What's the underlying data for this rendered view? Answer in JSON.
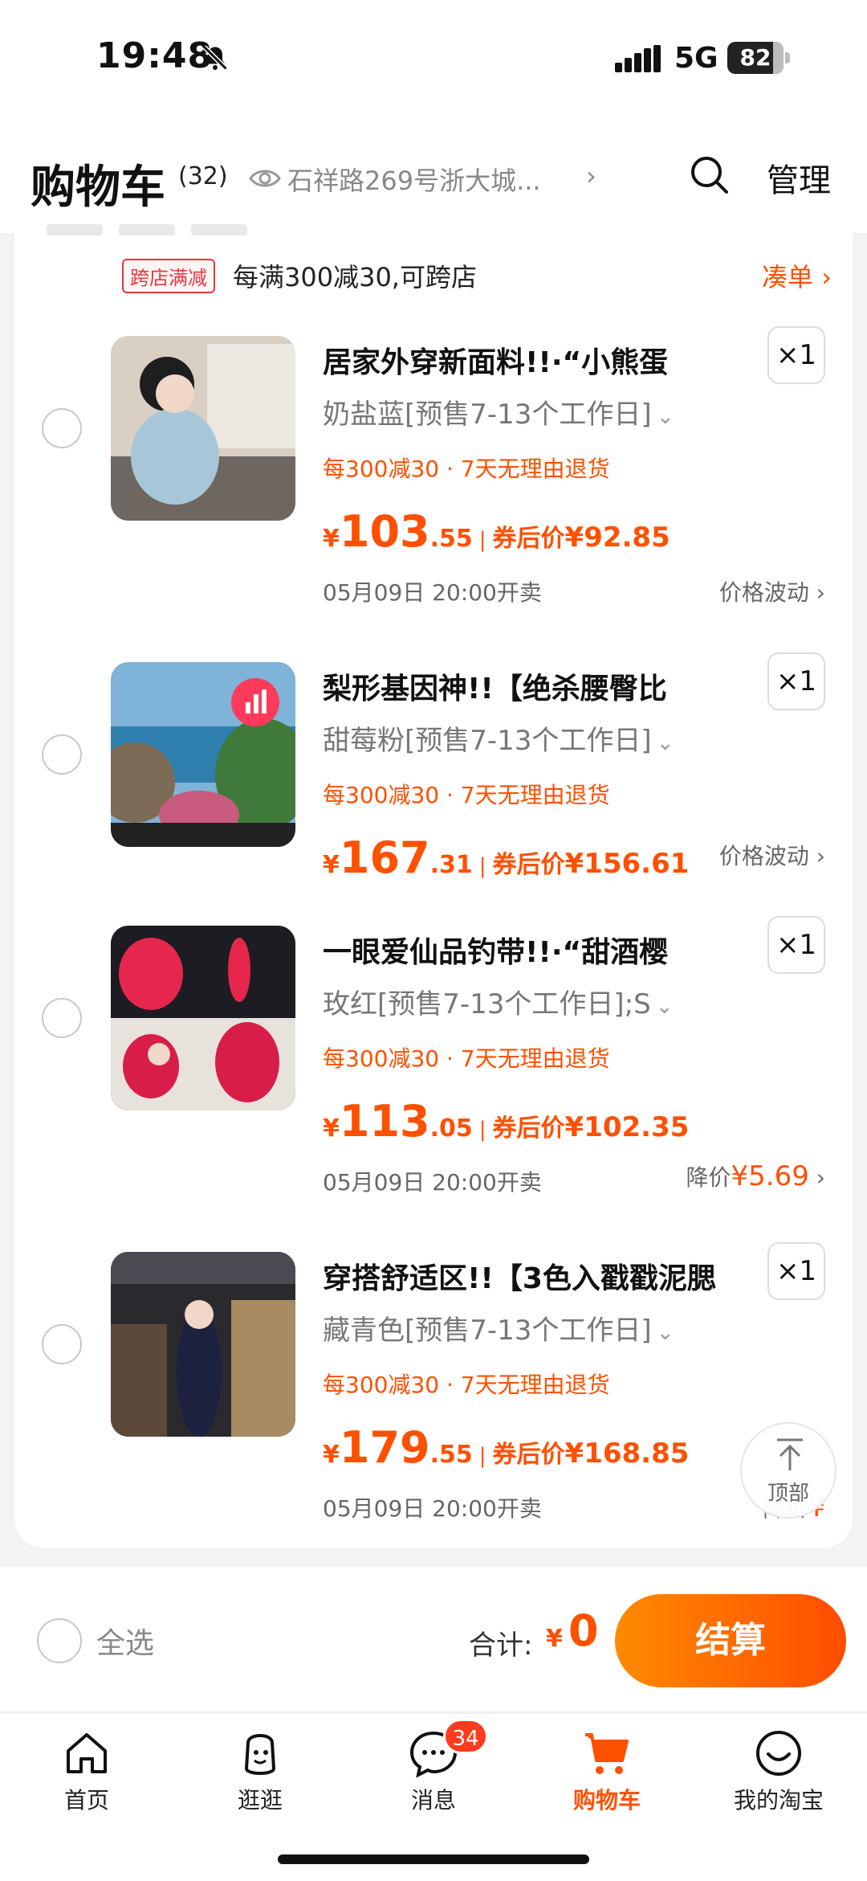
{
  "status_bar": {
    "time": "19:48",
    "network": "5G",
    "battery": "82",
    "battery_level": 82,
    "icons": [
      "bell-muted-icon",
      "signal-icon",
      "battery-icon"
    ]
  },
  "header": {
    "title": "购物车",
    "count": "(32)",
    "address": "石祥路269号浙大城...",
    "address_chevron": "›",
    "manage_label": "管理"
  },
  "promo": {
    "tag": "跨店满减",
    "text": "每满300减30,可跨店",
    "link": "凑单 ›"
  },
  "items": [
    {
      "title": "居家外穿新面料!!·“小熊蛋",
      "sku": "奶盐蓝[预售7-13个工作日]",
      "tags": "每300减30 · 7天无理由退货",
      "price_yen": "¥",
      "price_int": "103",
      "price_dec": ".55",
      "coupon_label": "券后价",
      "coupon_price": "¥92.85",
      "sale_time": "05月09日 20:00开卖",
      "note": "价格波动",
      "note_accent": "",
      "qty": "×1"
    },
    {
      "title": "梨形基因神!!【绝杀腰臀比",
      "sku": "甜莓粉[预售7-13个工作日]",
      "tags": "每300减30 · 7天无理由退货",
      "price_yen": "¥",
      "price_int": "167",
      "price_dec": ".31",
      "coupon_label": "券后价",
      "coupon_price": "¥156.61",
      "sale_time": "",
      "note": "价格波动",
      "note_accent": "",
      "qty": "×1"
    },
    {
      "title": "一眼爱仙品钓带!!·“甜酒樱",
      "sku": "玫红[预售7-13个工作日];S",
      "tags": "每300减30 · 7天无理由退货",
      "price_yen": "¥",
      "price_int": "113",
      "price_dec": ".05",
      "coupon_label": "券后价",
      "coupon_price": "¥102.35",
      "sale_time": "05月09日 20:00开卖",
      "note": "降价",
      "note_accent": "¥5.69",
      "qty": "×1"
    },
    {
      "title": "穿搭舒适区!!【3色入戳戳泥腮",
      "sku": "藏青色[预售7-13个工作日]",
      "tags": "每300减30 · 7天无理由退货",
      "price_yen": "¥",
      "price_int": "179",
      "price_dec": ".55",
      "coupon_label": "券后价",
      "coupon_price": "¥168.85",
      "sale_time": "05月09日 20:00开卖",
      "note": "降价",
      "note_accent": "¥",
      "qty": "×1"
    }
  ],
  "scroll_top": {
    "label": "顶部"
  },
  "checkout": {
    "select_all": "全选",
    "total_label": "合计:",
    "total_yen": "¥",
    "total_value": "0",
    "button": "结算"
  },
  "tabs": [
    {
      "label": "首页",
      "icon": "home-icon"
    },
    {
      "label": "逛逛",
      "icon": "explore-icon"
    },
    {
      "label": "消息",
      "icon": "message-icon",
      "badge": "34"
    },
    {
      "label": "购物车",
      "icon": "cart-icon",
      "active": true
    },
    {
      "label": "我的淘宝",
      "icon": "profile-icon"
    }
  ],
  "colors": {
    "accent": "#ff5000",
    "promo_tag": "#e4393c",
    "badge": "#ff3b1f"
  }
}
